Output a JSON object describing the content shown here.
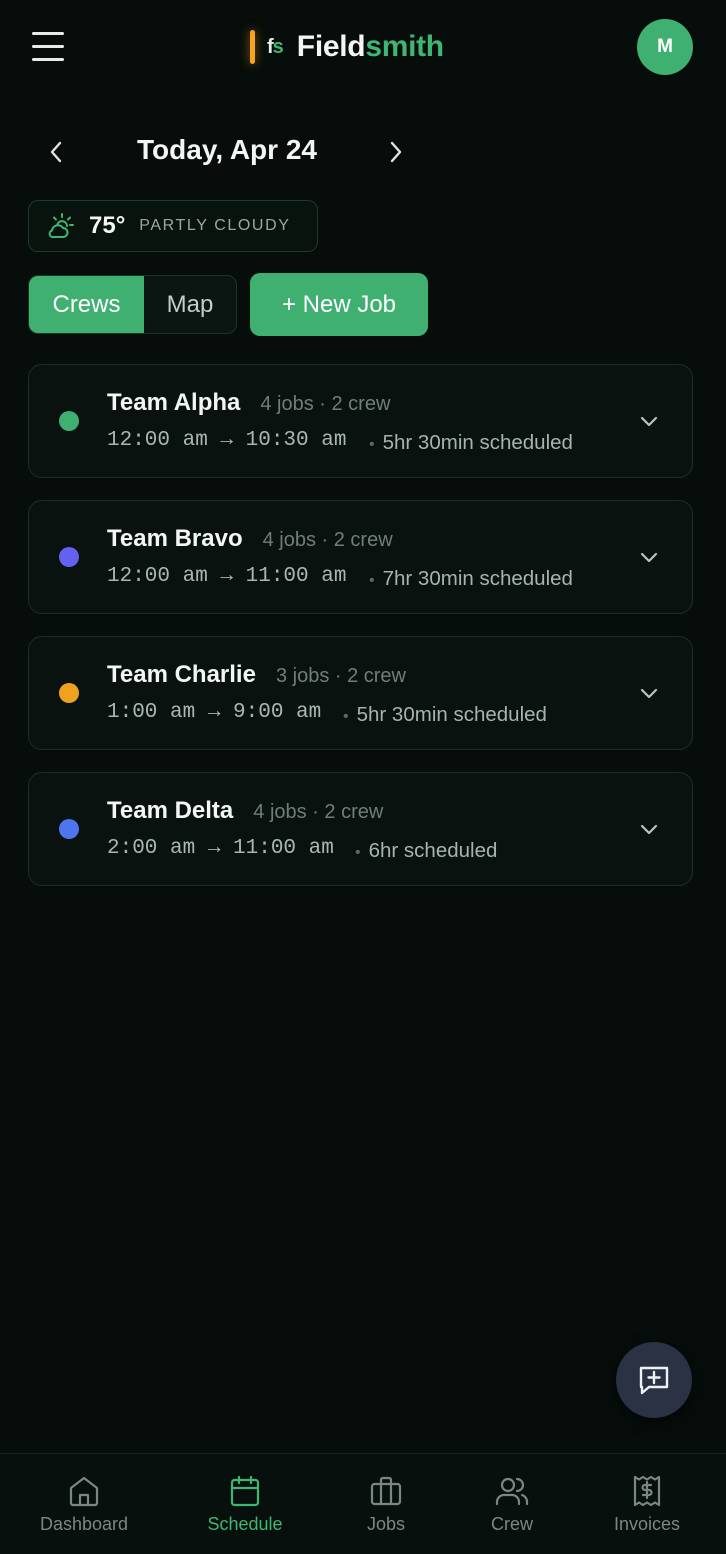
{
  "header": {
    "brand_mono_f": "f",
    "brand_mono_s": "s",
    "brand_name_a": "Field",
    "brand_name_b": "smith",
    "avatar_initial": "M"
  },
  "date_nav": {
    "title": "Today, Apr 24"
  },
  "weather": {
    "icon": "partly-cloudy-icon",
    "temp": "75°",
    "condition": "PARTLY CLOUDY"
  },
  "toolbar": {
    "crews_label": "Crews",
    "map_label": "Map",
    "new_job_label": "+ New Job"
  },
  "crews": [
    {
      "name": "Team Alpha",
      "meta": "4 jobs · 2 crew",
      "time": "12:00 am → 10:30 am",
      "scheduled": "5hr 30min scheduled",
      "color": "#3fb06f"
    },
    {
      "name": "Team Bravo",
      "meta": "4 jobs · 2 crew",
      "time": "12:00 am → 11:00 am",
      "scheduled": "7hr 30min scheduled",
      "color": "#6460f0"
    },
    {
      "name": "Team Charlie",
      "meta": "3 jobs · 2 crew",
      "time": "1:00 am → 9:00 am",
      "scheduled": "5hr 30min scheduled",
      "color": "#efa11f"
    },
    {
      "name": "Team Delta",
      "meta": "4 jobs · 2 crew",
      "time": "2:00 am → 11:00 am",
      "scheduled": "6hr scheduled",
      "color": "#4f74ef"
    }
  ],
  "bottom_nav": [
    {
      "label": "Dashboard",
      "icon": "home-icon",
      "active": false
    },
    {
      "label": "Schedule",
      "icon": "calendar-icon",
      "active": true
    },
    {
      "label": "Jobs",
      "icon": "briefcase-icon",
      "active": false
    },
    {
      "label": "Crew",
      "icon": "users-icon",
      "active": false
    },
    {
      "label": "Invoices",
      "icon": "receipt-icon",
      "active": false
    }
  ],
  "colors": {
    "accent": "#3fb06f",
    "background": "#060d0a",
    "brand_bar": "#f5a524"
  }
}
